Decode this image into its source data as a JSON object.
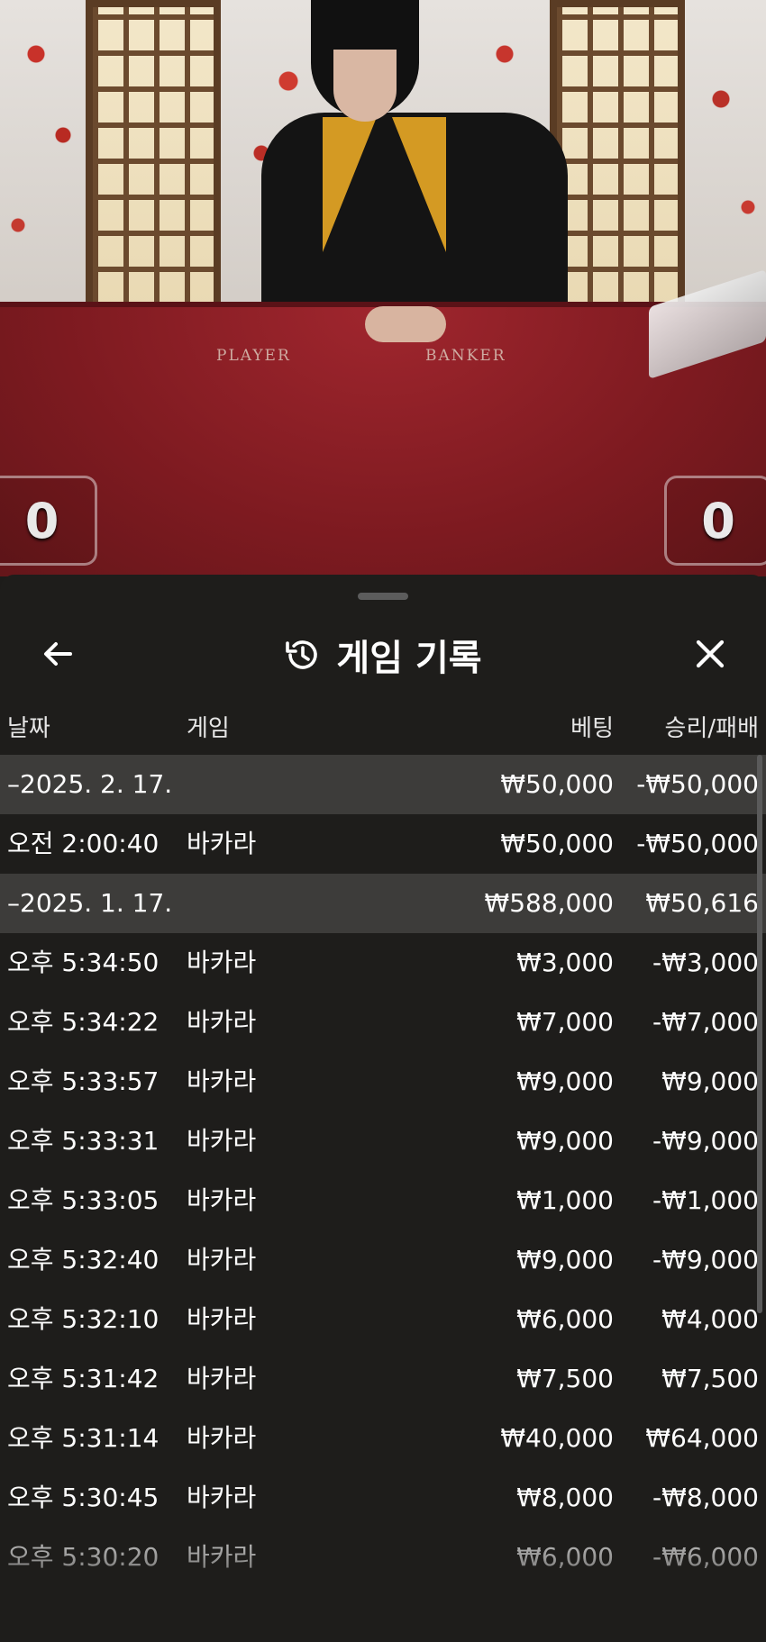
{
  "video": {
    "table_labels": {
      "player": "PLAYER",
      "banker": "BANKER"
    },
    "player_score": "0",
    "banker_score": "0"
  },
  "sheet": {
    "title": "게임 기록",
    "icons": {
      "back": "arrow-left-icon",
      "history": "history-icon",
      "close": "close-icon"
    },
    "columns": {
      "date": "날짜",
      "game": "게임",
      "bet": "베팅",
      "winloss": "승리/패배"
    },
    "rows": [
      {
        "type": "group",
        "date": "–2025. 2. 17.",
        "game": "",
        "bet": "₩50,000",
        "winloss": "-₩50,000"
      },
      {
        "type": "item",
        "date": "오전 2:00:40",
        "game": "바카라",
        "bet": "₩50,000",
        "winloss": "-₩50,000"
      },
      {
        "type": "group",
        "date": "–2025. 1. 17.",
        "game": "",
        "bet": "₩588,000",
        "winloss": "₩50,616"
      },
      {
        "type": "item",
        "date": "오후 5:34:50",
        "game": "바카라",
        "bet": "₩3,000",
        "winloss": "-₩3,000"
      },
      {
        "type": "item",
        "date": "오후 5:34:22",
        "game": "바카라",
        "bet": "₩7,000",
        "winloss": "-₩7,000"
      },
      {
        "type": "item",
        "date": "오후 5:33:57",
        "game": "바카라",
        "bet": "₩9,000",
        "winloss": "₩9,000"
      },
      {
        "type": "item",
        "date": "오후 5:33:31",
        "game": "바카라",
        "bet": "₩9,000",
        "winloss": "-₩9,000"
      },
      {
        "type": "item",
        "date": "오후 5:33:05",
        "game": "바카라",
        "bet": "₩1,000",
        "winloss": "-₩1,000"
      },
      {
        "type": "item",
        "date": "오후 5:32:40",
        "game": "바카라",
        "bet": "₩9,000",
        "winloss": "-₩9,000"
      },
      {
        "type": "item",
        "date": "오후 5:32:10",
        "game": "바카라",
        "bet": "₩6,000",
        "winloss": "₩4,000"
      },
      {
        "type": "item",
        "date": "오후 5:31:42",
        "game": "바카라",
        "bet": "₩7,500",
        "winloss": "₩7,500"
      },
      {
        "type": "item",
        "date": "오후 5:31:14",
        "game": "바카라",
        "bet": "₩40,000",
        "winloss": "₩64,000"
      },
      {
        "type": "item",
        "date": "오후 5:30:45",
        "game": "바카라",
        "bet": "₩8,000",
        "winloss": "-₩8,000"
      },
      {
        "type": "item",
        "date": "오후 5:30:20",
        "game": "바카라",
        "bet": "₩6,000",
        "winloss": "-₩6,000"
      }
    ]
  }
}
